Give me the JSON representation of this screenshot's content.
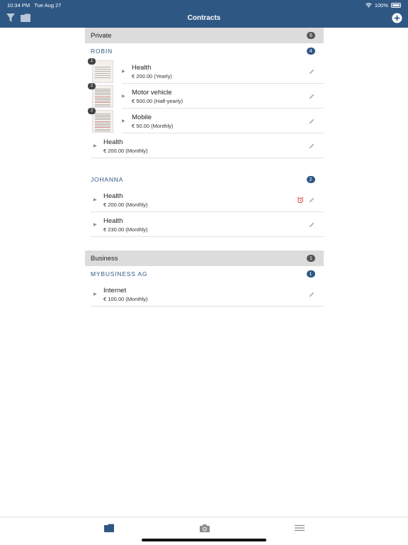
{
  "status": {
    "time": "10:34 PM",
    "date": "Tue Aug 27",
    "battery": "100%"
  },
  "nav": {
    "title": "Contracts"
  },
  "sections": [
    {
      "title": "Private",
      "count": "6",
      "groups": [
        {
          "name": "ROBIN",
          "count": "4",
          "items": [
            {
              "name": "Health",
              "price": "€ 200.00 (Yearly)",
              "docs": "1",
              "thumbStyle": "photo",
              "alarm": false
            },
            {
              "name": "Motor vehicle",
              "price": "€ 500.00 (Half-yearly)",
              "docs": "2",
              "thumbStyle": "doc",
              "alarm": false
            },
            {
              "name": "Mobile",
              "price": "€ 50.00 (Monthly)",
              "docs": "2",
              "thumbStyle": "doc",
              "alarm": false
            },
            {
              "name": "Health",
              "price": "€ 200.00 (Monthly)",
              "docs": "",
              "thumbStyle": "",
              "alarm": false
            }
          ]
        },
        {
          "name": "JOHANNA",
          "count": "2",
          "items": [
            {
              "name": "Health",
              "price": "€ 200.00 (Monthly)",
              "docs": "",
              "thumbStyle": "",
              "alarm": true
            },
            {
              "name": "Health",
              "price": "€ 230.00 (Monthly)",
              "docs": "",
              "thumbStyle": "",
              "alarm": false
            }
          ]
        }
      ]
    },
    {
      "title": "Business",
      "count": "1",
      "groups": [
        {
          "name": "MYBUSINESS AG",
          "count": "1",
          "items": [
            {
              "name": "Internet",
              "price": "€ 100.00 (Monthly)",
              "docs": "",
              "thumbStyle": "",
              "alarm": false
            }
          ]
        }
      ]
    }
  ],
  "colors": {
    "brand": "#2f5783",
    "alarm": "#d0352f",
    "sectionBg": "#dcdcdc"
  },
  "icons": {
    "filter": "filter-icon",
    "folder": "folder-icon",
    "add": "add-icon",
    "edit": "pencil-icon",
    "alarm": "alarm-clock-icon",
    "camera": "camera-icon",
    "menu": "menu-icon"
  }
}
